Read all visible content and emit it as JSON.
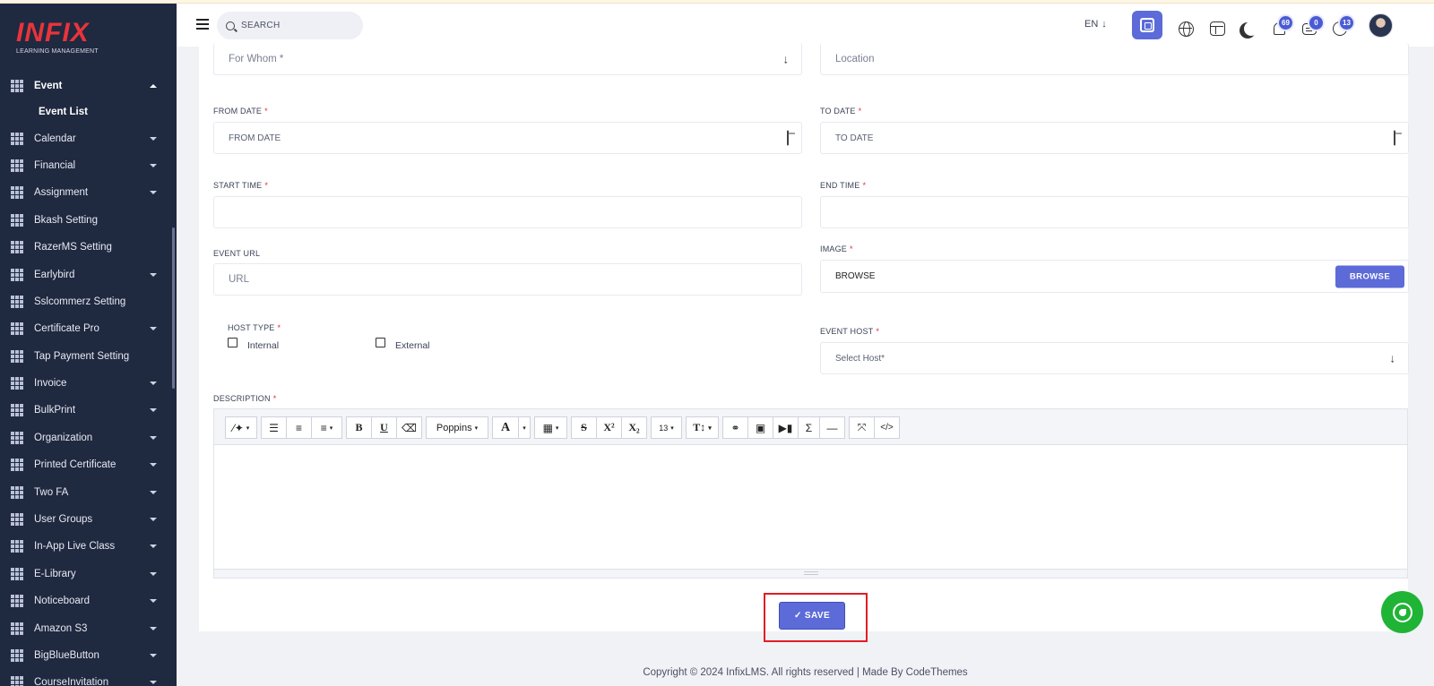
{
  "app": {
    "brand": "INFIX",
    "brand_sub": "LEARNING MANAGEMENT"
  },
  "header": {
    "search_placeholder": "SEARCH",
    "language": "EN",
    "notifications": {
      "bell": "69",
      "messages": "0",
      "chat": "13"
    }
  },
  "sidebar": {
    "active_parent": "Event",
    "active_child": "Event List",
    "items": [
      {
        "label": "Calendar",
        "caret": true
      },
      {
        "label": "Financial",
        "caret": true
      },
      {
        "label": "Assignment",
        "caret": true
      },
      {
        "label": "Bkash Setting",
        "caret": false
      },
      {
        "label": "RazerMS Setting",
        "caret": false
      },
      {
        "label": "Earlybird",
        "caret": true
      },
      {
        "label": "Sslcommerz Setting",
        "caret": false
      },
      {
        "label": "Certificate Pro",
        "caret": true
      },
      {
        "label": "Tap Payment Setting",
        "caret": false
      },
      {
        "label": "Invoice",
        "caret": true
      },
      {
        "label": "BulkPrint",
        "caret": true
      },
      {
        "label": "Organization",
        "caret": true
      },
      {
        "label": "Printed Certificate",
        "caret": true
      },
      {
        "label": "Two FA",
        "caret": true
      },
      {
        "label": "User Groups",
        "caret": true
      },
      {
        "label": "In-App Live Class",
        "caret": true
      },
      {
        "label": "E-Library",
        "caret": true
      },
      {
        "label": "Noticeboard",
        "caret": true
      },
      {
        "label": "Amazon S3",
        "caret": true
      },
      {
        "label": "BigBlueButton",
        "caret": true
      },
      {
        "label": "CourseInvitation",
        "caret": true
      }
    ]
  },
  "form": {
    "for_whom_placeholder": "For Whom *",
    "location_placeholder": "Location",
    "from_date_label": "FROM DATE",
    "from_date_placeholder": "FROM DATE",
    "to_date_label": "TO DATE",
    "to_date_placeholder": "TO DATE",
    "start_time_label": "START TIME",
    "end_time_label": "END TIME",
    "event_url_label": "EVENT URL",
    "event_url_placeholder": "URL",
    "image_label": "IMAGE",
    "image_value": "BROWSE",
    "browse_button": "BROWSE",
    "host_type_label": "HOST TYPE",
    "host_internal": "Internal",
    "host_external": "External",
    "event_host_label": "EVENT HOST",
    "event_host_placeholder": "Select Host*",
    "description_label": "DESCRIPTION",
    "required_mark": "*"
  },
  "editor": {
    "font_name": "Poppins",
    "font_size": "13"
  },
  "actions": {
    "save_label": "✓ SAVE"
  },
  "footer": {
    "text": "Copyright © 2024 InfixLMS. All rights reserved | Made By CodeThemes"
  }
}
